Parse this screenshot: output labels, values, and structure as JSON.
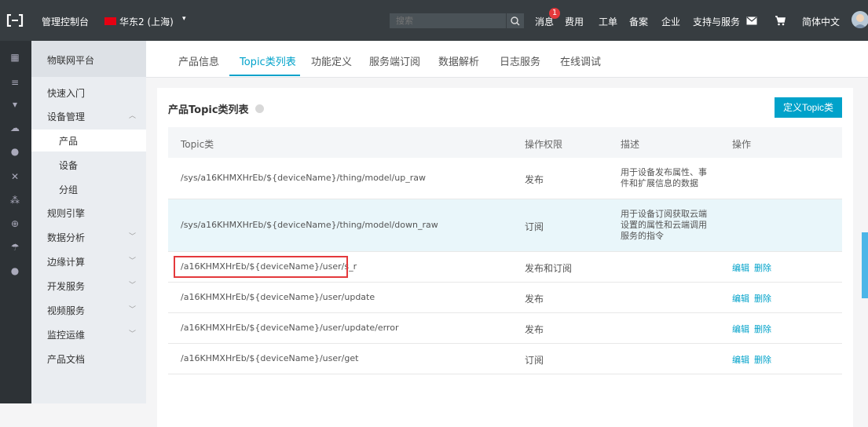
{
  "topbar": {
    "console_label": "管理控制台",
    "region_label": "华东2 (上海)",
    "region_caret": "▾",
    "search_placeholder": "搜索",
    "message_label": "消息",
    "message_badge": "1",
    "fees_label": "费用",
    "ticket_label": "工单",
    "beian_label": "备案",
    "enterprise_label": "企业",
    "support_label": "支持与服务",
    "lang_label": "简体中文"
  },
  "sidebar": {
    "title": "物联网平台",
    "items": [
      {
        "label": "快速入门"
      },
      {
        "label": "设备管理"
      },
      {
        "label": "产品"
      },
      {
        "label": "设备"
      },
      {
        "label": "分组"
      },
      {
        "label": "规则引擎"
      },
      {
        "label": "数据分析"
      },
      {
        "label": "边缘计算"
      },
      {
        "label": "开发服务"
      },
      {
        "label": "视频服务"
      },
      {
        "label": "监控运维"
      },
      {
        "label": "产品文档"
      }
    ]
  },
  "tabs": [
    {
      "label": "产品信息"
    },
    {
      "label": "Topic类列表"
    },
    {
      "label": "功能定义"
    },
    {
      "label": "服务端订阅"
    },
    {
      "label": "数据解析"
    },
    {
      "label": "日志服务"
    },
    {
      "label": "在线调试"
    }
  ],
  "card": {
    "title": "产品Topic类列表",
    "define_button": "定义Topic类",
    "columns": [
      "Topic类",
      "操作权限",
      "描述",
      "操作"
    ],
    "rows": [
      {
        "topic": "/sys/a16KHMXHrEb/${deviceName}/thing/model/up_raw",
        "perm": "发布",
        "desc": "用于设备发布属性、事件和扩展信息的数据",
        "edit": "",
        "del": ""
      },
      {
        "topic": "/sys/a16KHMXHrEb/${deviceName}/thing/model/down_raw",
        "perm": "订阅",
        "desc": "用于设备订阅获取云端设置的属性和云端调用服务的指令",
        "edit": "",
        "del": ""
      },
      {
        "topic": "/a16KHMXHrEb/${deviceName}/user/s_r",
        "perm": "发布和订阅",
        "desc": "",
        "edit": "编辑",
        "del": "删除"
      },
      {
        "topic": "/a16KHMXHrEb/${deviceName}/user/update",
        "perm": "发布",
        "desc": "",
        "edit": "编辑",
        "del": "删除"
      },
      {
        "topic": "/a16KHMXHrEb/${deviceName}/user/update/error",
        "perm": "发布",
        "desc": "",
        "edit": "编辑",
        "del": "删除"
      },
      {
        "topic": "/a16KHMXHrEb/${deviceName}/user/get",
        "perm": "订阅",
        "desc": "",
        "edit": "编辑",
        "del": "删除"
      }
    ]
  },
  "icons": {
    "logo": "aliyun-logo-icon",
    "search": "search-icon",
    "mail": "mail-icon",
    "cart": "cart-icon",
    "help": "help-icon"
  },
  "colors": {
    "accent": "#00a2ca",
    "topbar": "#373d41",
    "highlight_row": "#e9f6fa",
    "alert": "#e4393c"
  }
}
